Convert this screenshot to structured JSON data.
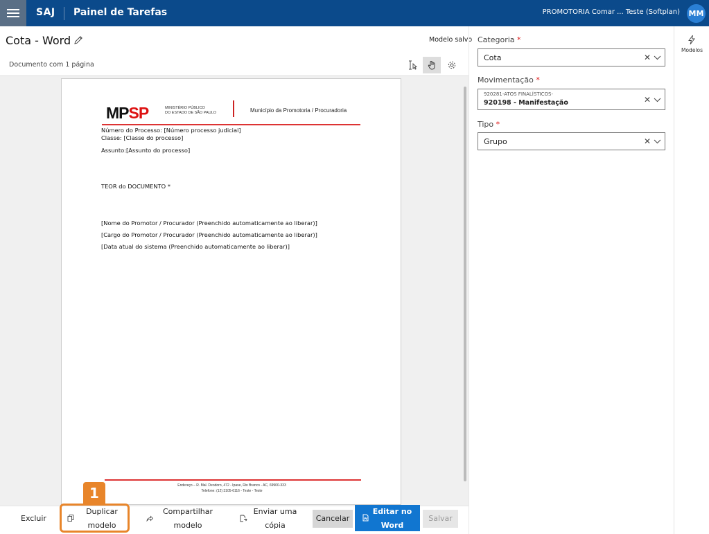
{
  "topbar": {
    "brand": "SAJ",
    "title": "Painel de Tarefas",
    "org": "PROMOTORIA Comar ... Teste (Softplan)",
    "avatar": "MM"
  },
  "document": {
    "title": "Cota - Word",
    "saved_status": "Modelo salvo",
    "page_count": "Documento com 1 página"
  },
  "page_content": {
    "logo_mp": "MP",
    "logo_sp": "SP",
    "logo_sub_1": "MINISTÉRIO PÚBLICO",
    "logo_sub_2": "DO ESTADO DE SÃO PAULO",
    "municipio": "Município da Promotoria / Procuradoria",
    "lines": [
      "Número do Processo: [Número processo judicial]",
      "Classe: [Classe do processo]",
      "Assunto:[Assunto do processo]",
      "TEOR do DOCUMENTO *",
      "[Nome do Promotor / Procurador (Preenchido automaticamente ao liberar)]",
      "[Cargo do Promotor / Procurador (Preenchido automaticamente ao liberar)]",
      "[Data atual do sistema (Preenchido automaticamente ao liberar)]"
    ],
    "footer_1": "Endereço – R. Mal. Deodoro, 472 - Ipase, Rio Branco - AC, 69900-333",
    "footer_2": "Telefone: (12) 3105-6116 - Teste - Teste"
  },
  "actions": {
    "excluir": "Excluir",
    "duplicar_1": "Duplicar",
    "duplicar_2": "modelo",
    "compartilhar_1": "Compartilhar",
    "compartilhar_2": "modelo",
    "enviar_1": "Enviar uma",
    "enviar_2": "cópia",
    "cancelar": "Cancelar",
    "editar_1": "Editar no",
    "editar_2": "Word",
    "salvar": "Salvar"
  },
  "step_badge": "1",
  "form": {
    "categoria_label": "Categoria",
    "categoria_value": "Cota",
    "movimentacao_label": "Movimentação",
    "movimentacao_sub": "920281-ATOS FINALÍSTICOS-",
    "movimentacao_value": "920198 - Manifestação",
    "tipo_label": "Tipo",
    "tipo_value": "Grupo",
    "required_mark": "*"
  },
  "side": {
    "modelos_label": "Modelos"
  },
  "colors": {
    "topbar": "#0b4a8b",
    "primary_button": "#1176d0",
    "highlight": "#e8852a",
    "logo_red": "#dd1111"
  }
}
